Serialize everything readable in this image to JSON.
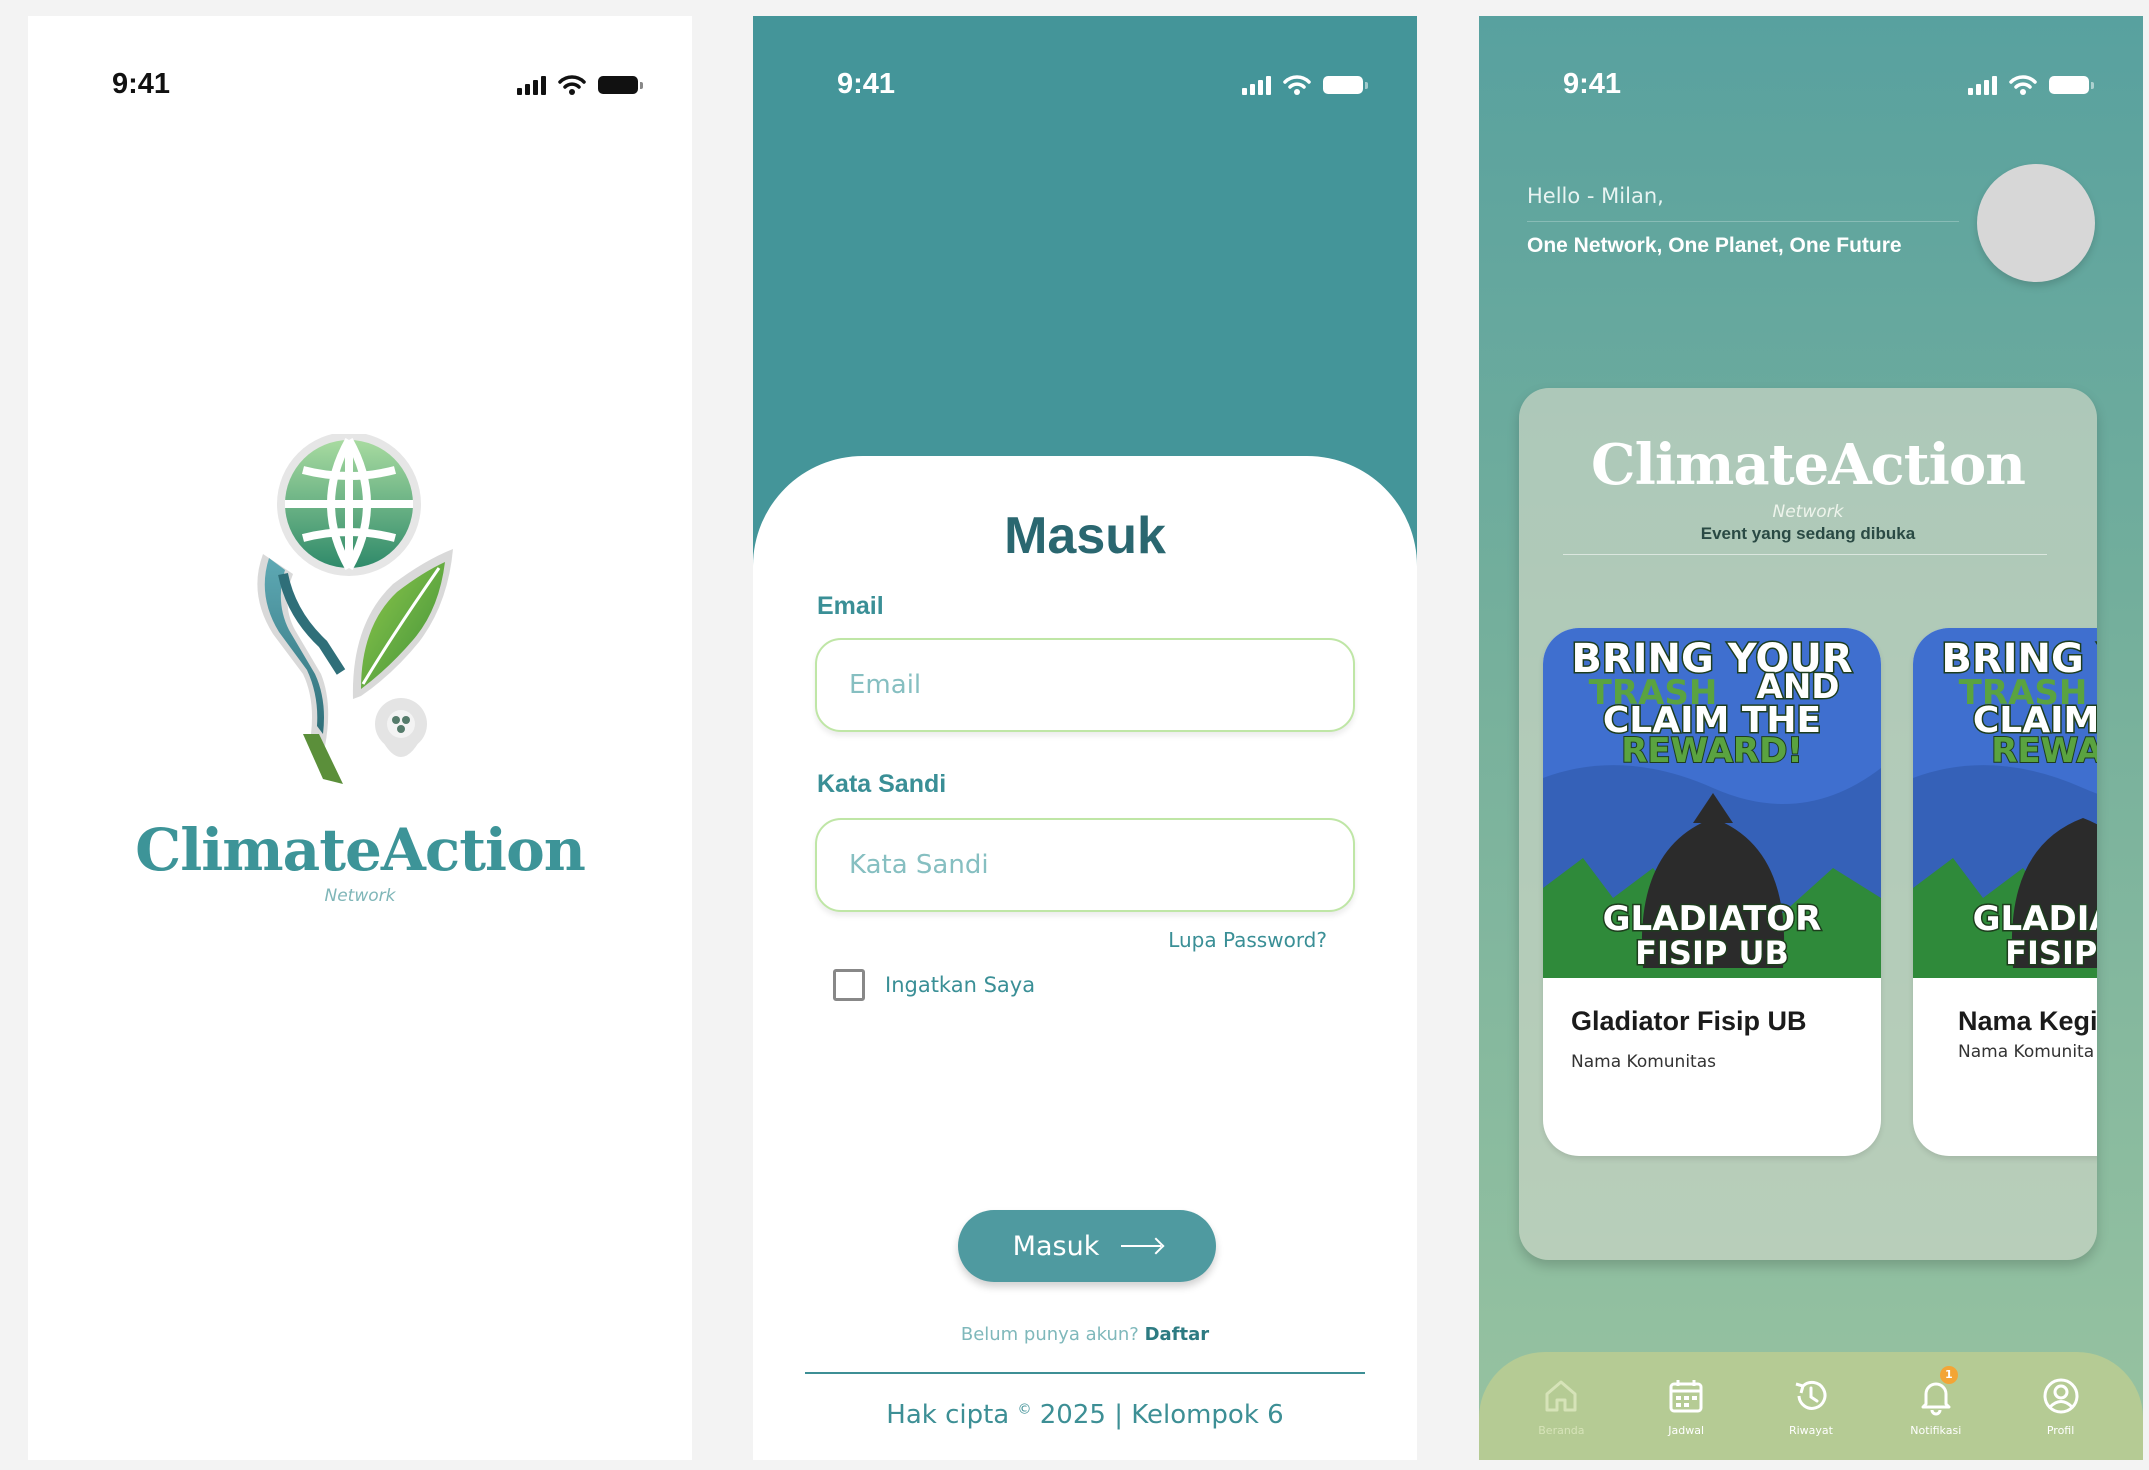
{
  "status_bar": {
    "time": "9:41"
  },
  "splash": {
    "brand": "ClimateAction",
    "brand_sub": "Network"
  },
  "login": {
    "title": "Masuk",
    "email_label": "Email",
    "email_placeholder": "Email",
    "password_label": "Kata Sandi",
    "password_placeholder": "Kata Sandi",
    "forgot_password": "Lupa Password?",
    "remember_me": "Ingatkan Saya",
    "remember_checked": false,
    "submit_label": "Masuk",
    "no_account": "Belum punya akun?",
    "signup": "Daftar",
    "copyright_prefix": "Hak cipta",
    "copyright_symbol": "©",
    "copyright_suffix": "2025 | Kelompok 6"
  },
  "home": {
    "greeting": "Hello - Milan,",
    "tagline": "One Network, One Planet, One Future",
    "panel": {
      "brand": "ClimateAction",
      "brand_sub": "Network",
      "caption": "Event yang sedang dibuka"
    },
    "poster": {
      "line1": "BRING YOUR",
      "line2": "TRASH",
      "line3": "AND",
      "line4": "CLAIM THE",
      "line5": "REWARD!",
      "line6": "GLADIATOR",
      "line7": "FISIP UB"
    },
    "events": [
      {
        "title": "Gladiator Fisip UB",
        "community": "Nama Komunitas"
      },
      {
        "title": "Nama Kegi",
        "community": "Nama Komunita"
      }
    ],
    "nav": [
      {
        "label": "Beranda",
        "icon": "home-icon"
      },
      {
        "label": "Jadwal",
        "icon": "calendar-icon"
      },
      {
        "label": "Riwayat",
        "icon": "history-icon"
      },
      {
        "label": "Notifikasi",
        "icon": "bell-icon",
        "badge": "1"
      },
      {
        "label": "Profil",
        "icon": "profile-icon"
      }
    ]
  },
  "colors": {
    "teal": "#449599",
    "teal_dark": "#2a6770",
    "green_accent": "#bfe6a6",
    "nav_bg": "#b5cb94",
    "badge": "#f3a536"
  }
}
